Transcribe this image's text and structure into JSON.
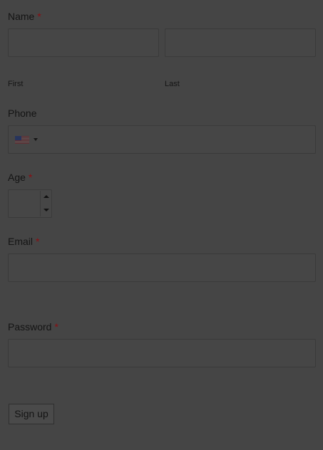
{
  "form": {
    "name": {
      "label": "Name",
      "required_mark": "*",
      "first_sublabel": "First",
      "last_sublabel": "Last",
      "first_value": "",
      "last_value": ""
    },
    "phone": {
      "label": "Phone",
      "country_flag": "us-flag-icon",
      "value": ""
    },
    "age": {
      "label": "Age",
      "required_mark": "*",
      "value": ""
    },
    "email": {
      "label": "Email",
      "required_mark": "*",
      "value": ""
    },
    "password": {
      "label": "Password",
      "required_mark": "*",
      "value": ""
    },
    "submit_label": "Sign up"
  },
  "colors": {
    "background": "#454545",
    "required": "#8a0d12",
    "field_border": "#3a3a3a"
  }
}
